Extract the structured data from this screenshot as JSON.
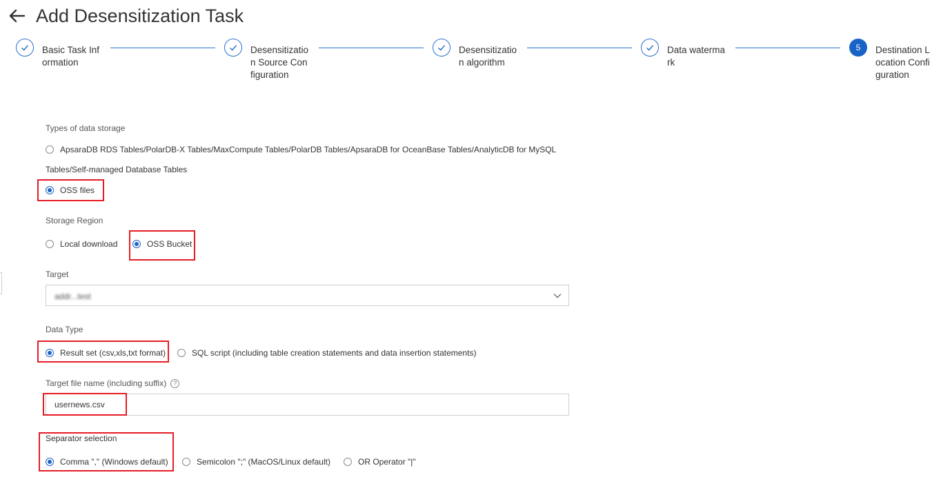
{
  "header": {
    "title": "Add Desensitization Task"
  },
  "steps": [
    {
      "label": "Basic Task Information",
      "state": "done"
    },
    {
      "label": "Desensitization Source Configuration",
      "state": "done"
    },
    {
      "label": "Desensitization algorithm",
      "state": "done"
    },
    {
      "label": "Data watermark",
      "state": "done"
    },
    {
      "label": "Destination Location Configuration",
      "state": "active",
      "number": "5"
    }
  ],
  "storage_type": {
    "label": "Types of data storage",
    "option1": "ApsaraDB RDS Tables/PolarDB-X Tables/MaxCompute Tables/PolarDB Tables/ApsaraDB for OceanBase Tables/AnalyticDB for MySQL",
    "option1_cont": "Tables/Self-managed Database Tables",
    "option2": "OSS files",
    "selected": "OSS files"
  },
  "storage_region": {
    "label": "Storage Region",
    "options": [
      "Local download",
      "OSS Bucket"
    ],
    "selected": "OSS Bucket"
  },
  "target": {
    "label": "Target",
    "value": "addr...test"
  },
  "data_type": {
    "label": "Data Type",
    "options": [
      "Result set (csv,xls,txt format)",
      "SQL script (including table creation statements and data insertion statements)"
    ],
    "selected": "Result set (csv,xls,txt format)"
  },
  "file_name": {
    "label": "Target file name (including suffix)",
    "value": "usernews.csv"
  },
  "separator": {
    "label": "Separator selection",
    "options": [
      "Comma \",\" (Windows default)",
      "Semicolon \";\" (MacOS/Linux default)",
      "OR Operator \"|\""
    ],
    "selected": "Comma \",\" (Windows default)"
  },
  "colors": {
    "accent": "#1a63c6",
    "highlight": "#e51b24"
  }
}
